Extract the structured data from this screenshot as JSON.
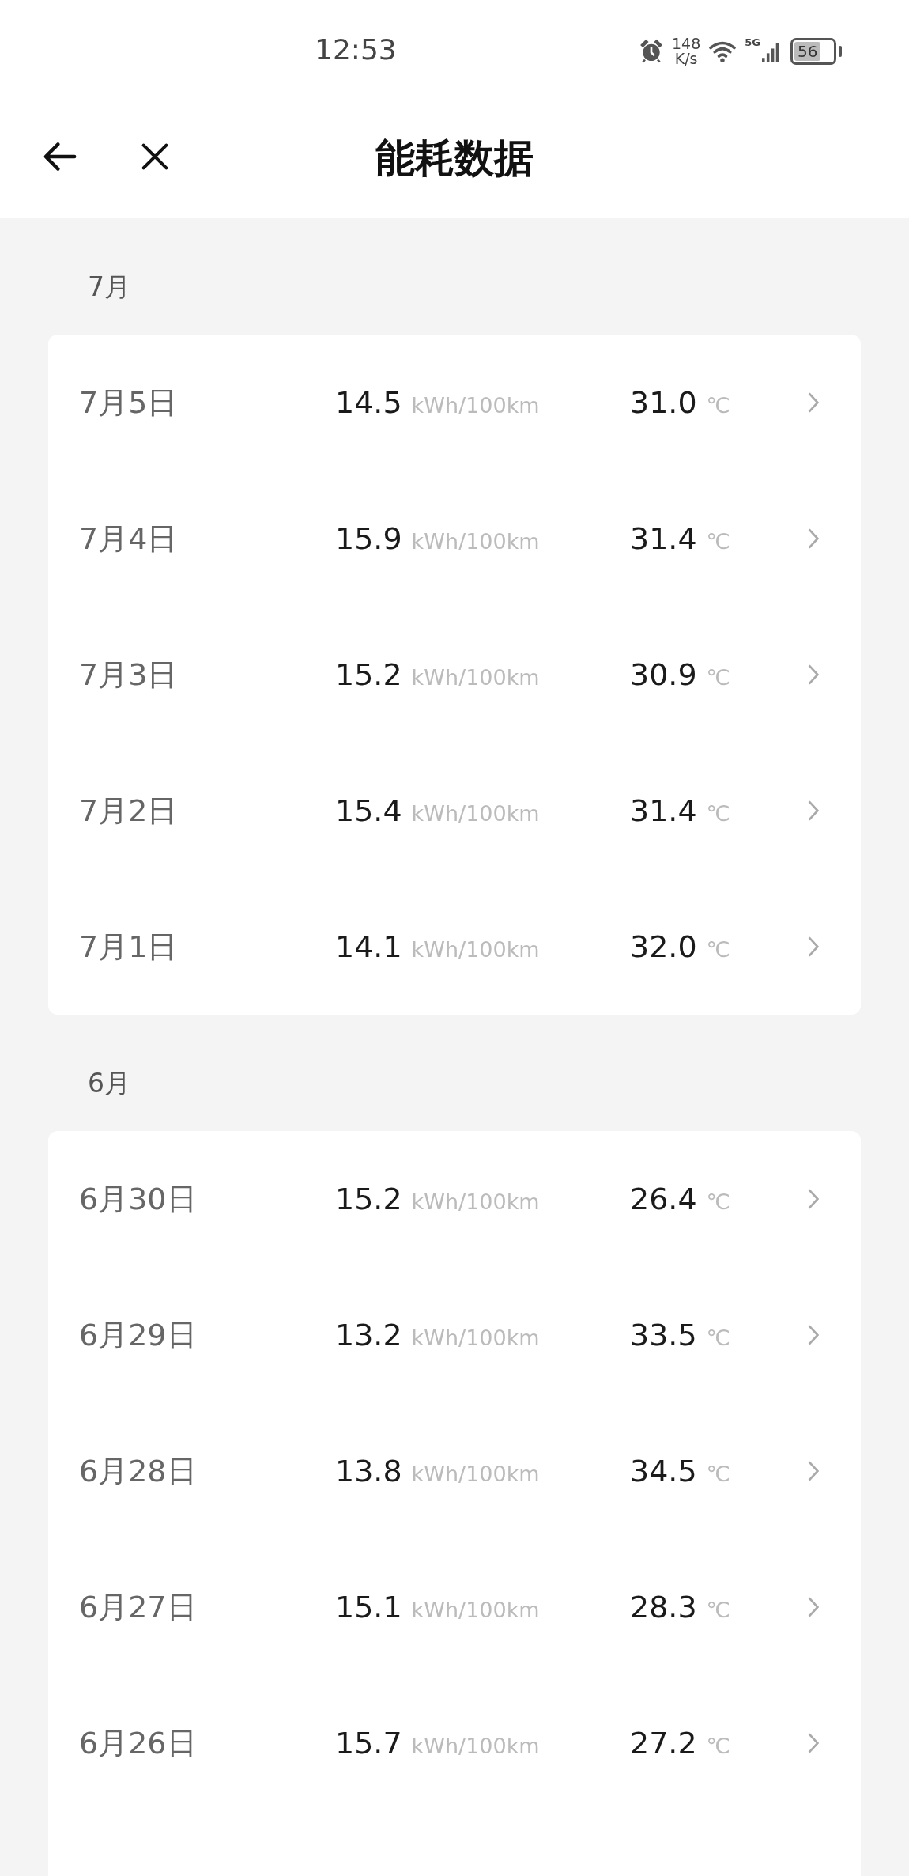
{
  "status_bar": {
    "time": "12:53",
    "net_speed": "148",
    "net_speed_unit": "K/s",
    "network": "5G",
    "battery": "56"
  },
  "header": {
    "title": "能耗数据"
  },
  "months": [
    {
      "label": "7月",
      "rows": [
        {
          "date": "7月5日",
          "consumption": "14.5",
          "consumption_unit": "kWh/100km",
          "temperature": "31.0",
          "temperature_unit": "℃"
        },
        {
          "date": "7月4日",
          "consumption": "15.9",
          "consumption_unit": "kWh/100km",
          "temperature": "31.4",
          "temperature_unit": "℃"
        },
        {
          "date": "7月3日",
          "consumption": "15.2",
          "consumption_unit": "kWh/100km",
          "temperature": "30.9",
          "temperature_unit": "℃"
        },
        {
          "date": "7月2日",
          "consumption": "15.4",
          "consumption_unit": "kWh/100km",
          "temperature": "31.4",
          "temperature_unit": "℃"
        },
        {
          "date": "7月1日",
          "consumption": "14.1",
          "consumption_unit": "kWh/100km",
          "temperature": "32.0",
          "temperature_unit": "℃"
        }
      ]
    },
    {
      "label": "6月",
      "rows": [
        {
          "date": "6月30日",
          "consumption": "15.2",
          "consumption_unit": "kWh/100km",
          "temperature": "26.4",
          "temperature_unit": "℃"
        },
        {
          "date": "6月29日",
          "consumption": "13.2",
          "consumption_unit": "kWh/100km",
          "temperature": "33.5",
          "temperature_unit": "℃"
        },
        {
          "date": "6月28日",
          "consumption": "13.8",
          "consumption_unit": "kWh/100km",
          "temperature": "34.5",
          "temperature_unit": "℃"
        },
        {
          "date": "6月27日",
          "consumption": "15.1",
          "consumption_unit": "kWh/100km",
          "temperature": "28.3",
          "temperature_unit": "℃"
        },
        {
          "date": "6月26日",
          "consumption": "15.7",
          "consumption_unit": "kWh/100km",
          "temperature": "27.2",
          "temperature_unit": "℃"
        }
      ]
    }
  ]
}
